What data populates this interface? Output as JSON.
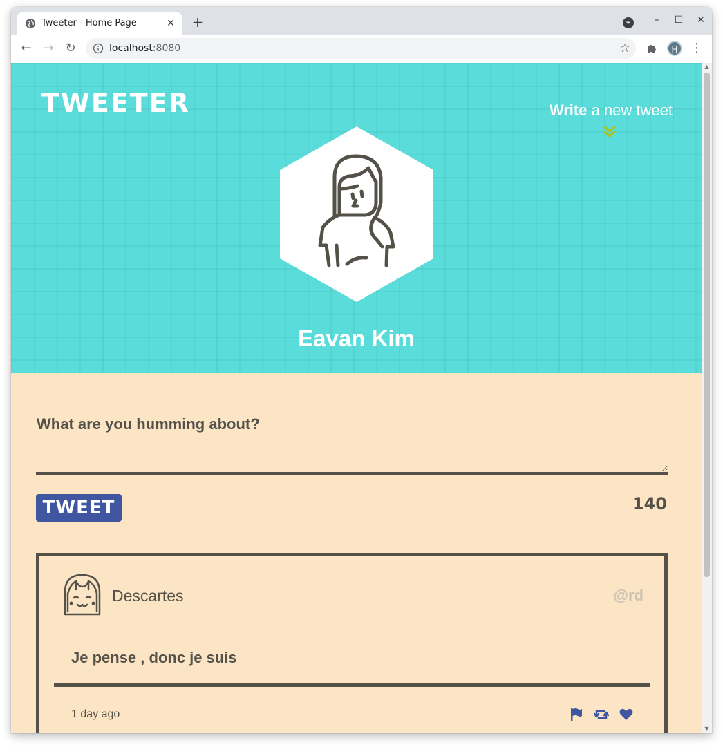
{
  "browser": {
    "tab_title": "Tweeter - Home Page",
    "url_host": "localhost",
    "url_port": ":8080",
    "profile_initial": "H"
  },
  "header": {
    "brand": "TWEETER",
    "compose_link_bold": "Write",
    "compose_link_rest": " a new tweet",
    "profile_name": "Eavan Kim"
  },
  "compose": {
    "prompt": "What are you humming about?",
    "input_value": "",
    "button_label": "TWEET",
    "char_count": "140"
  },
  "tweets": [
    {
      "author": "Descartes",
      "handle": "@rd",
      "text": "Je pense , donc je suis",
      "time": "1 day ago"
    }
  ],
  "colors": {
    "hero_bg": "#59dcda",
    "page_bg": "#fce5c5",
    "ink": "#545149",
    "accent_blue": "#4056a1",
    "arrow_green": "#a7c520"
  },
  "icons": [
    "globe-favicon-icon",
    "close-icon",
    "plus-icon",
    "back-icon",
    "forward-icon",
    "reload-icon",
    "info-icon",
    "star-icon",
    "extensions-icon",
    "menu-icon",
    "double-chevron-down-icon",
    "flag-icon",
    "retweet-icon",
    "heart-icon"
  ]
}
